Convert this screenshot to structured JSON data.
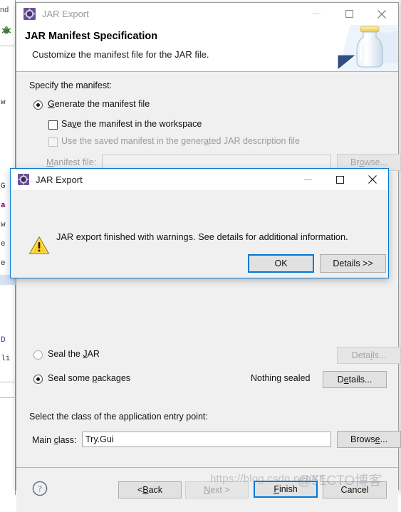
{
  "background": {
    "tab_label": "nd",
    "code_fragments": [
      "G",
      "a",
      "w",
      "e",
      "e",
      "D",
      "li"
    ]
  },
  "wizard": {
    "titlebar": {
      "icon": "jar-export-icon",
      "title": "JAR Export",
      "minimize_label": "Minimize",
      "maximize_label": "Maximize",
      "close_label": "Close"
    },
    "header": {
      "title": "JAR Manifest Specification",
      "subtitle": "Customize the manifest file for the JAR file.",
      "art": "jar-bottle-icon"
    },
    "manifest": {
      "section_label": "Specify the manifest:",
      "generate_radio": {
        "label": "Generate the manifest file",
        "mnemonic": "G",
        "selected": true
      },
      "save_checkbox": {
        "label": "Save the manifest in the workspace",
        "mnemonic": "v",
        "checked": false,
        "enabled": true
      },
      "use_saved_checkbox": {
        "label": "Use the saved manifest in the generated JAR description file",
        "mnemonic": "a",
        "checked": false,
        "enabled": false
      },
      "manifest_file": {
        "label": "Manifest file:",
        "mnemonic": "M",
        "value": "",
        "enabled": false
      },
      "browse_button": {
        "label": "Browse...",
        "mnemonic": "o",
        "enabled": false
      }
    },
    "sealing": {
      "seal_jar_radio": {
        "label": "Seal the JAR",
        "mnemonic": "J",
        "selected": false
      },
      "seal_jar_details_button": {
        "label": "Details...",
        "mnemonic": "i",
        "enabled": false
      },
      "seal_packages_radio": {
        "label": "Seal some packages",
        "mnemonic": "p",
        "selected": true
      },
      "seal_status": "Nothing sealed",
      "seal_packages_details_button": {
        "label": "Details...",
        "mnemonic": "e",
        "enabled": true
      }
    },
    "entry_point": {
      "section_label": "Select the class of the application entry point:",
      "main_class": {
        "label": "Main class:",
        "mnemonic": "c",
        "value": "Try.Gui"
      },
      "browse_button": {
        "label": "Browse...",
        "mnemonic": "e"
      }
    },
    "footer": {
      "help_icon": "help-question-icon",
      "back_button": {
        "label": "< Back",
        "mnemonic": "B",
        "enabled": true
      },
      "next_button": {
        "label": "Next >",
        "mnemonic": "N",
        "enabled": false
      },
      "finish_button": {
        "label": "Finish",
        "mnemonic": "F",
        "enabled": true,
        "default": true
      },
      "cancel_button": {
        "label": "Cancel",
        "enabled": true
      }
    }
  },
  "modal": {
    "titlebar": {
      "icon": "jar-export-icon",
      "title": "JAR Export",
      "minimize_label": "Minimize",
      "maximize_label": "Maximize",
      "close_label": "Close"
    },
    "warning_icon": "warning-triangle-icon",
    "message": "JAR export finished with warnings. See details for additional information.",
    "ok_button": {
      "label": "OK",
      "default": true
    },
    "details_button": {
      "label": "Details >>"
    }
  },
  "watermark": {
    "url_text": "https://blog.csdn.net/YE",
    "site_text": "@51CTO博客"
  },
  "colors": {
    "accent": "#0078d7",
    "window_bg": "#f0f0f0",
    "titlebar_bg": "#ffffff",
    "warning_yellow": "#ffd11a",
    "icon_purple": "#6a4e9c"
  }
}
